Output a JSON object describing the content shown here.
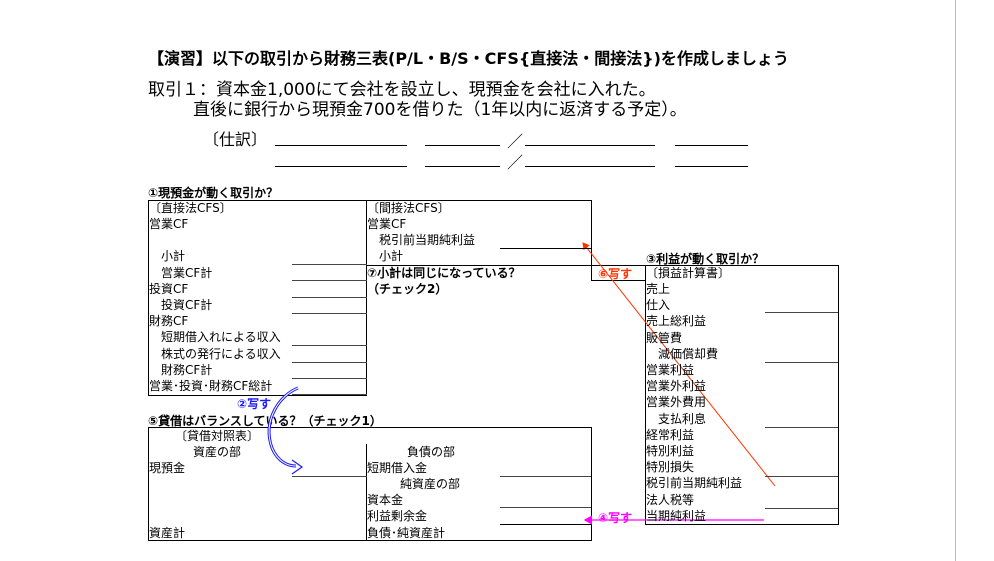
{
  "title": "【演習】以下の取引から財務三表(P/L・B/S・CFS{直接法・間接法})を作成しましょう",
  "transaction": {
    "line1": "取引１：資本金1,000にて会社を設立し、現預金を会社に入れた。",
    "line2": "直後に銀行から現預金700を借りた（1年以内に返済する予定）。"
  },
  "journal": {
    "label": "〔仕訳〕",
    "slash": "／"
  },
  "q1": "①現預金が動く取引か？",
  "direct_cfs": {
    "header": "〔直接法CFS〕",
    "rows": [
      "営業CF",
      "",
      "　小計",
      "　営業CF計",
      "投資CF",
      "　投資CF計",
      "財務CF",
      "　短期借入れによる収入",
      "　株式の発行による収入",
      "　財務CF計",
      "営業･投資･財務CF総計"
    ]
  },
  "indirect_cfs": {
    "header": "〔間接法CFS〕",
    "rows": [
      "営業CF",
      "　税引前当期純利益",
      "　小計"
    ]
  },
  "q7": {
    "line1": "⑦小計は同じになっている？",
    "line2": "（チェック2）"
  },
  "q3": "③利益が動く取引か？",
  "pl": {
    "header": "〔損益計算書〕",
    "rows": [
      "売上",
      "仕入",
      "売上総利益",
      "販管費",
      "　減価償却費",
      "営業利益",
      "営業外利益",
      "営業外費用",
      "　支払利息",
      "経常利益",
      "特別利益",
      "特別損失",
      "税引前当期純利益",
      "法人税等",
      "当期純利益"
    ]
  },
  "q5": "⑤貸借はバランスしている？（チェック1）",
  "bs": {
    "header": "〔貸借対照表〕",
    "assets_title": "資産の部",
    "cash": "現預金",
    "assets_total": "資産計",
    "liab_title": "負債の部",
    "short_loan": "短期借入金",
    "equity_title": "純資産の部",
    "capital": "資本金",
    "retained": "利益剰余金",
    "total": "負債･純資産計"
  },
  "copy_labels": {
    "c2": "②写す",
    "c4": "④写す",
    "c6": "⑥写す"
  },
  "colors": {
    "blue": "#1a1aff",
    "magenta": "#ff00ff",
    "red": "#ff3300"
  }
}
